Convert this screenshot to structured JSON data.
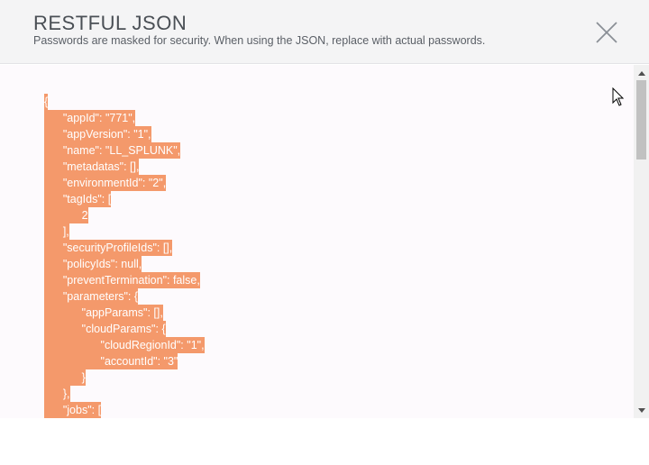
{
  "dialog": {
    "title": "RESTFUL JSON",
    "subtitle": "Passwords are masked for security. When using the JSON, replace with actual passwords."
  },
  "json_lines": [
    {
      "indent": 0,
      "text": "{"
    },
    {
      "indent": 1,
      "text": "\"appId\": \"771\","
    },
    {
      "indent": 1,
      "text": "\"appVersion\": \"1\","
    },
    {
      "indent": 1,
      "text": "\"name\": \"LL_SPLUNK\","
    },
    {
      "indent": 1,
      "text": "\"metadatas\": [],"
    },
    {
      "indent": 1,
      "text": "\"environmentId\": \"2\","
    },
    {
      "indent": 1,
      "text": "\"tagIds\": ["
    },
    {
      "indent": 2,
      "text": "2"
    },
    {
      "indent": 1,
      "text": "],"
    },
    {
      "indent": 1,
      "text": "\"securityProfileIds\": [],"
    },
    {
      "indent": 1,
      "text": "\"policyIds\": null,"
    },
    {
      "indent": 1,
      "text": "\"preventTermination\": false,"
    },
    {
      "indent": 1,
      "text": "\"parameters\": {"
    },
    {
      "indent": 2,
      "text": "\"appParams\": [],"
    },
    {
      "indent": 2,
      "text": "\"cloudParams\": {"
    },
    {
      "indent": 3,
      "text": "\"cloudRegionId\": \"1\","
    },
    {
      "indent": 3,
      "text": "\"accountId\": \"3\""
    },
    {
      "indent": 2,
      "text": "}"
    },
    {
      "indent": 1,
      "text": "},"
    },
    {
      "indent": 1,
      "text": "\"jobs\": ["
    }
  ],
  "icons": {
    "close": "close-icon",
    "scroll_up": "arrow-up-icon",
    "scroll_down": "arrow-down-icon",
    "cursor": "mouse-pointer-icon"
  },
  "colors": {
    "selection": "#f4996b",
    "header_bg": "#f4f4f5",
    "body_bg": "#fdfafd"
  }
}
